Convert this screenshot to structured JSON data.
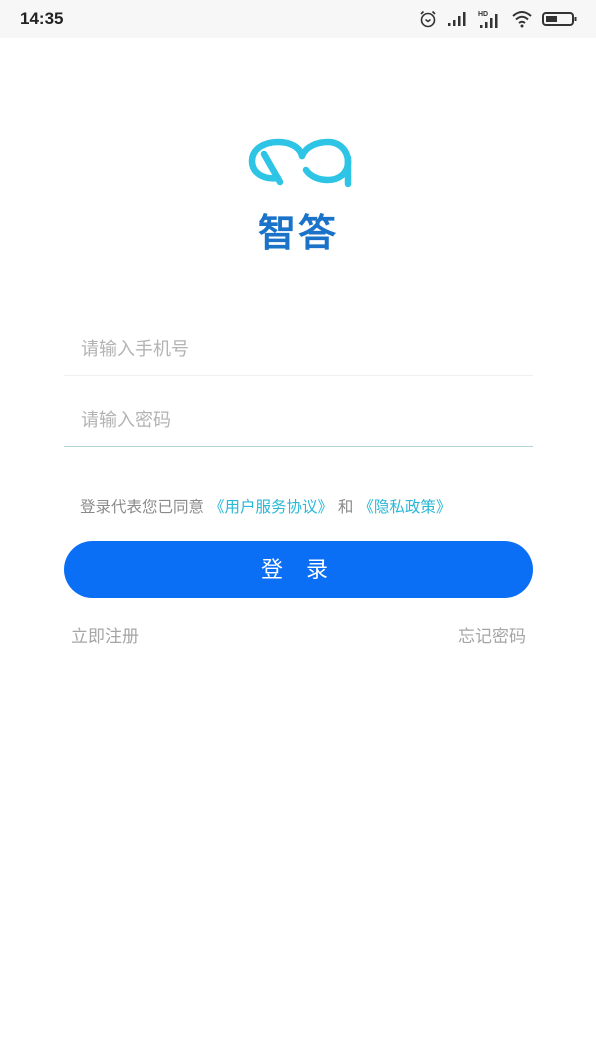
{
  "status_bar": {
    "time": "14:35",
    "icons": [
      "alarm-icon",
      "signal-icon",
      "hd-signal-icon",
      "wifi-icon",
      "battery-icon"
    ],
    "hd_label": "HD"
  },
  "brand": {
    "logo": "qa-logo",
    "name": "智答",
    "logo_color": "#2ec4e6",
    "name_color": "#1a73c8"
  },
  "form": {
    "phone_placeholder": "请输入手机号",
    "phone_value": "",
    "password_placeholder": "请输入密码",
    "password_value": ""
  },
  "agreement": {
    "prefix": "登录代表您已同意",
    "terms_link": "《用户服务协议》",
    "conjunction": "和",
    "privacy_link": "《隐私政策》",
    "link_color": "#29b8d6"
  },
  "actions": {
    "login_label": "登 录",
    "login_color": "#0a6ff5",
    "register_label": "立即注册",
    "forgot_label": "忘记密码"
  }
}
